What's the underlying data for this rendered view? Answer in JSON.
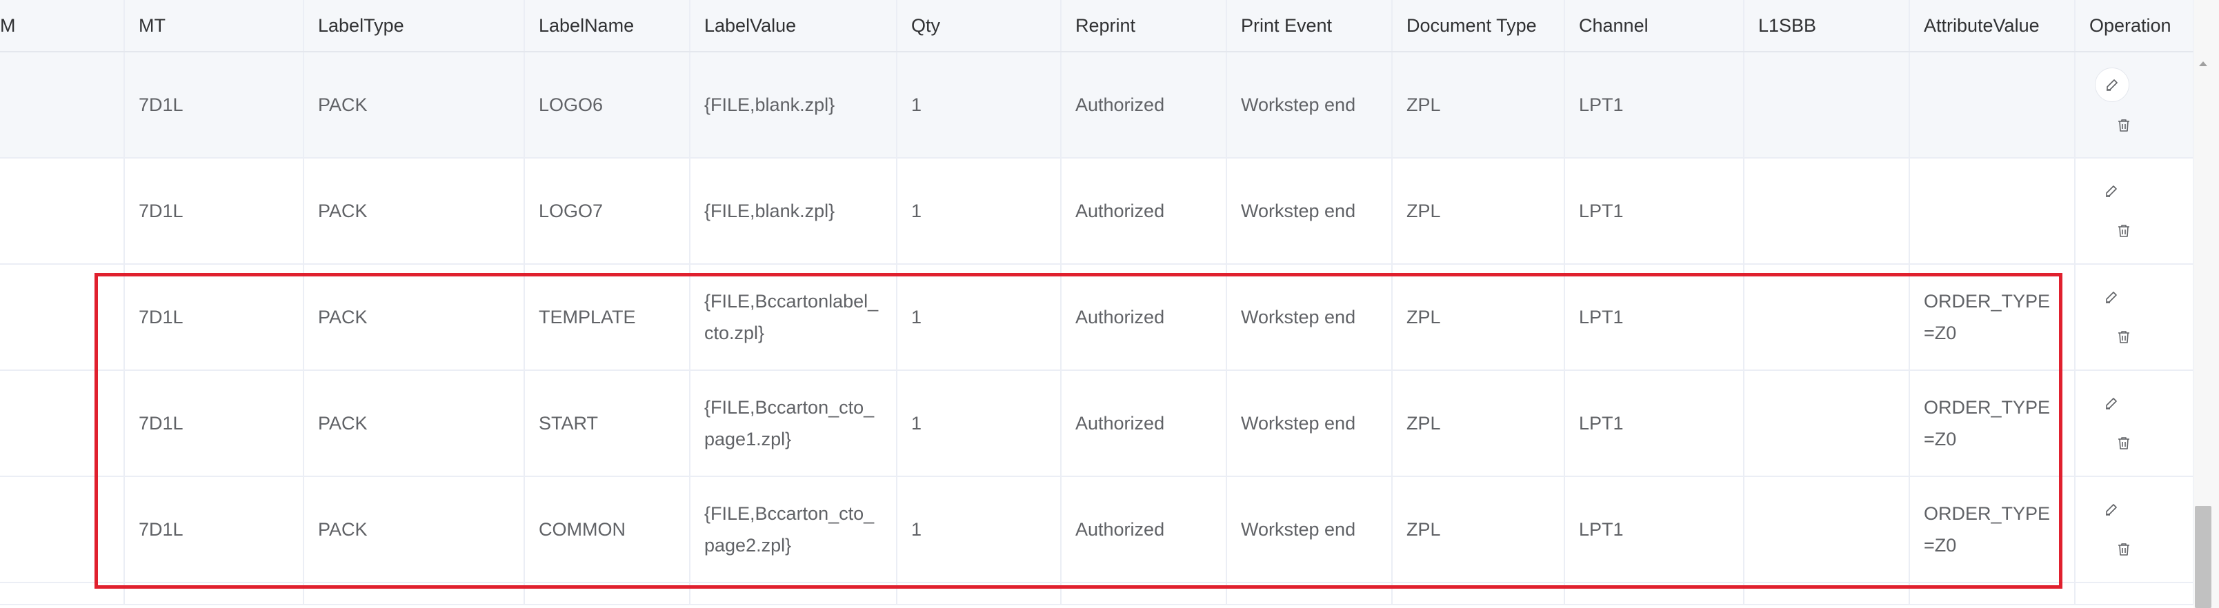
{
  "table": {
    "headers": {
      "m_partial": "M",
      "mt": "MT",
      "label_type": "LabelType",
      "label_name": "LabelName",
      "label_value": "LabelValue",
      "qty": "Qty",
      "reprint": "Reprint",
      "print_event": "Print Event",
      "document_type": "Document Type",
      "channel": "Channel",
      "l1sbb": "L1SBB",
      "attribute_value": "AttributeValue",
      "operation": "Operation"
    },
    "rows": [
      {
        "m": "",
        "mt": "7D1L",
        "label_type": "PACK",
        "label_name": "LOGO6",
        "label_value": "{FILE,blank.zpl}",
        "qty": "1",
        "reprint": "Authorized",
        "print_event": "Workstep end",
        "document_type": "ZPL",
        "channel": "LPT1",
        "l1sbb": "",
        "attribute_value": ""
      },
      {
        "m": "",
        "mt": "7D1L",
        "label_type": "PACK",
        "label_name": "LOGO7",
        "label_value": "{FILE,blank.zpl}",
        "qty": "1",
        "reprint": "Authorized",
        "print_event": "Workstep end",
        "document_type": "ZPL",
        "channel": "LPT1",
        "l1sbb": "",
        "attribute_value": ""
      },
      {
        "m": "",
        "mt": "7D1L",
        "label_type": "PACK",
        "label_name": "TEMPLATE",
        "label_value": "{FILE,Bccartonlabel_cto.zpl}",
        "qty": "1",
        "reprint": "Authorized",
        "print_event": "Workstep end",
        "document_type": "ZPL",
        "channel": "LPT1",
        "l1sbb": "",
        "attribute_value": "ORDER_TYPE=Z0"
      },
      {
        "m": "",
        "mt": "7D1L",
        "label_type": "PACK",
        "label_name": "START",
        "label_value": "{FILE,Bccarton_cto_page1.zpl}",
        "qty": "1",
        "reprint": "Authorized",
        "print_event": "Workstep end",
        "document_type": "ZPL",
        "channel": "LPT1",
        "l1sbb": "",
        "attribute_value": "ORDER_TYPE=Z0"
      },
      {
        "m": "",
        "mt": "7D1L",
        "label_type": "PACK",
        "label_name": "COMMON",
        "label_value": "{FILE,Bccarton_cto_page2.zpl}",
        "qty": "1",
        "reprint": "Authorized",
        "print_event": "Workstep end",
        "document_type": "ZPL",
        "channel": "LPT1",
        "l1sbb": "",
        "attribute_value": "ORDER_TYPE=Z0"
      }
    ]
  },
  "icons": {
    "edit": "edit-pencil-icon",
    "delete": "trash-icon"
  },
  "colors": {
    "highlight_border": "#e0202e",
    "header_bg": "#f5f7fa",
    "hover_row_bg": "#f5f7fa",
    "border": "#ebeef5"
  }
}
